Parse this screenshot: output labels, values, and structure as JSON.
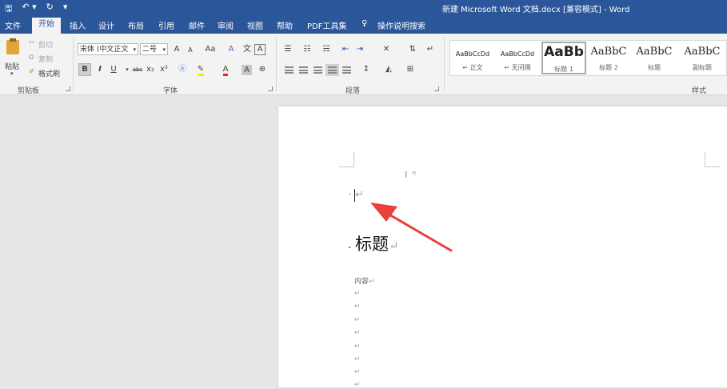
{
  "window": {
    "title": "新建 Microsoft Word 文档.docx [兼容模式] - Word"
  },
  "tabs": [
    {
      "label": "文件"
    },
    {
      "label": "开始"
    },
    {
      "label": "插入"
    },
    {
      "label": "设计"
    },
    {
      "label": "布局"
    },
    {
      "label": "引用"
    },
    {
      "label": "邮件"
    },
    {
      "label": "审阅"
    },
    {
      "label": "视图"
    },
    {
      "label": "帮助"
    },
    {
      "label": "PDF工具集"
    }
  ],
  "tell_me": {
    "label": "操作说明搜索"
  },
  "clipboard": {
    "paste": "粘贴",
    "cut": "剪切",
    "copy": "复制",
    "format_painter": "格式刷",
    "group_label": "剪贴板"
  },
  "font": {
    "name": "宋体 (中文正文",
    "size": "二号",
    "group_label": "字体",
    "bold": "B",
    "italic": "I",
    "underline": "U",
    "aa_case": "Aa",
    "big_a": "A",
    "small_a": "A",
    "strike": "abc",
    "subscript": "x₂",
    "superscript": "x²",
    "font_color": "A",
    "char_shading": "A",
    "clear_format": "A"
  },
  "paragraph": {
    "group_label": "段落"
  },
  "styles": {
    "group_label": "样式",
    "items": [
      {
        "preview": "AaBbCcDd",
        "label": "↵ 正文"
      },
      {
        "preview": "AaBbCcDd",
        "label": "↵ 无间隔"
      },
      {
        "preview": "AaBb",
        "label": "标题 1"
      },
      {
        "preview": "AaBbC",
        "label": "标题 2"
      },
      {
        "preview": "AaBbC",
        "label": "标题"
      },
      {
        "preview": "AaBbC",
        "label": "副标题"
      }
    ]
  },
  "document": {
    "heading": "标题",
    "body_first_line": "内容",
    "para_mark": "↵"
  },
  "colors": {
    "accent": "#2b579a",
    "arrow": "#e8413a"
  }
}
